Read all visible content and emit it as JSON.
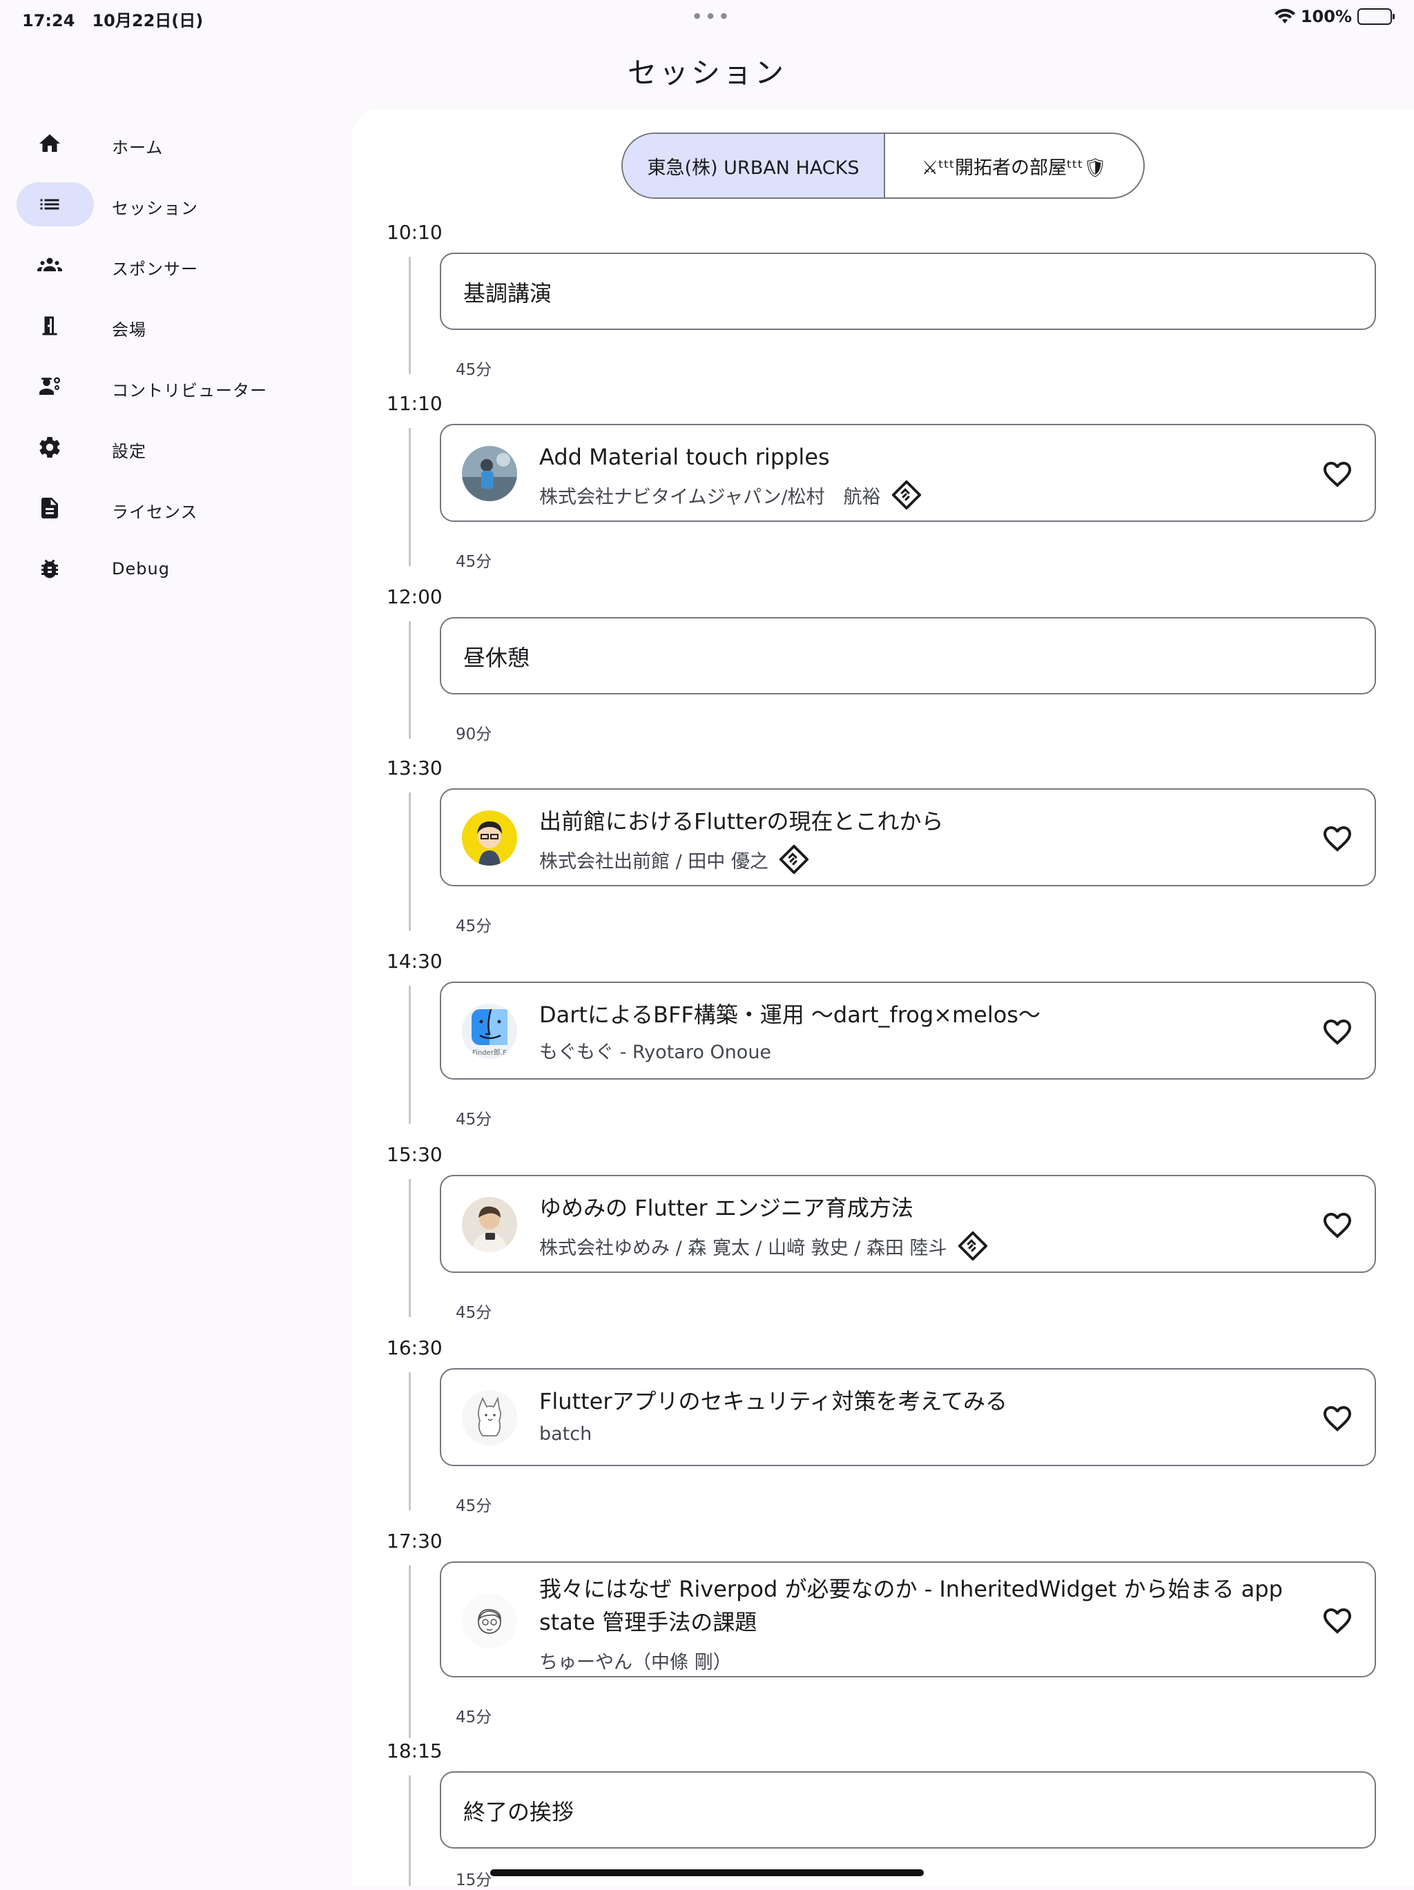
{
  "status": {
    "time": "17:24",
    "date": "10月22日(日)",
    "battery": "100%"
  },
  "app_title": "セッション",
  "sidebar": {
    "items": [
      {
        "label": "ホーム",
        "icon": "home-icon"
      },
      {
        "label": "セッション",
        "icon": "list-icon",
        "active": true
      },
      {
        "label": "スポンサー",
        "icon": "group-icon"
      },
      {
        "label": "会場",
        "icon": "door-icon"
      },
      {
        "label": "コントリビューター",
        "icon": "engineering-icon"
      },
      {
        "label": "設定",
        "icon": "gear-icon"
      },
      {
        "label": "ライセンス",
        "icon": "document-icon"
      },
      {
        "label": "Debug",
        "icon": "bug-icon"
      }
    ]
  },
  "rooms": {
    "selected": "東急(株) URBAN HACKS",
    "other": "⚔︎ᵗᵗᵗ開拓者の部屋ᵗᵗᵗ🛡"
  },
  "sessions": [
    {
      "time": "10:10",
      "title": "基調講演",
      "duration": "45分"
    },
    {
      "time": "11:10",
      "title": "Add Material touch ripples",
      "speaker": "株式会社ナビタイムジャパン/松村　航裕",
      "duration": "45分",
      "handshake": true
    },
    {
      "time": "12:00",
      "title": "昼休憩",
      "duration": "90分"
    },
    {
      "time": "13:30",
      "title": "出前館におけるFlutterの現在とこれから",
      "speaker": "株式会社出前館 / 田中 優之",
      "duration": "45分",
      "handshake": true
    },
    {
      "time": "14:30",
      "title": "DartによるBFF構築・運用 〜dart_frog×melos〜",
      "speaker": "もぐもぐ - Ryotaro Onoue",
      "duration": "45分",
      "avatar_text": "Finder郎.F"
    },
    {
      "time": "15:30",
      "title": "ゆめみの Flutter エンジニア育成方法",
      "speaker": "株式会社ゆめみ / 森 寛太 / 山﨑 敦史 / 森田 陸斗",
      "duration": "45分",
      "handshake": true
    },
    {
      "time": "16:30",
      "title": "Flutterアプリのセキュリティ対策を考えてみる",
      "speaker": "batch",
      "duration": "45分"
    },
    {
      "time": "17:30",
      "title_line1": "我々にはなぜ Riverpod が必要なのか - InheritedWidget から始まる app",
      "title_line2": "state 管理手法の課題",
      "speaker": "ちゅーやん（中條 剛）",
      "duration": "45分"
    },
    {
      "time": "18:15",
      "title": "終了の挨拶",
      "duration": "15分"
    }
  ],
  "colors": {
    "accent_container": "#dde1fb",
    "outline": "#75777f",
    "background": "#fbf9fc"
  }
}
